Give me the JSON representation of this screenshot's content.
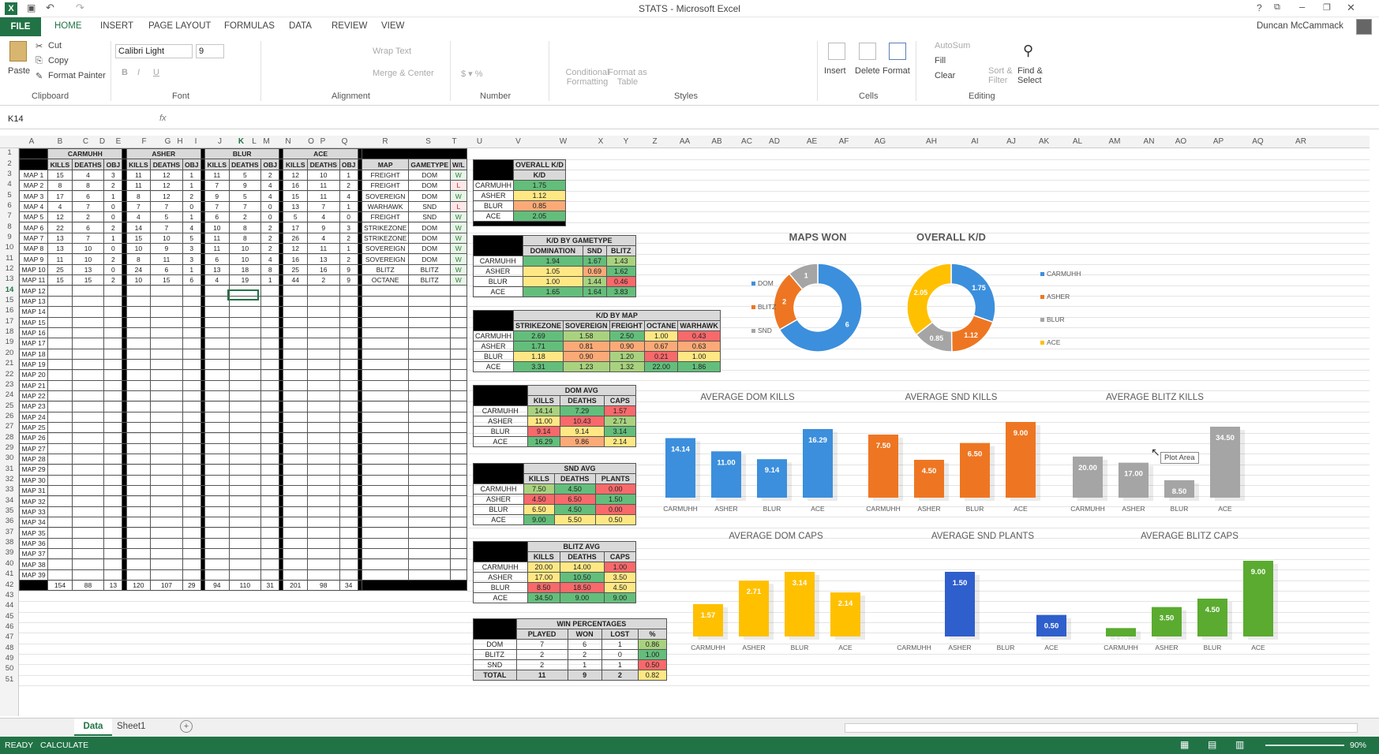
{
  "app": {
    "title": "STATS - Microsoft Excel",
    "user": "Duncan McCammack"
  },
  "ribbon_tabs": [
    "FILE",
    "HOME",
    "INSERT",
    "PAGE LAYOUT",
    "FORMULAS",
    "DATA",
    "REVIEW",
    "VIEW"
  ],
  "ribbon": {
    "paste": "Paste",
    "cut": "Cut",
    "copy": "Copy",
    "format_painter": "Format Painter",
    "font": "Calibri Light",
    "size": "9",
    "wrap": "Wrap Text",
    "merge": "Merge & Center",
    "cond": "Conditional Formatting",
    "fmt_table": "Format as Table",
    "insert": "Insert",
    "delete": "Delete",
    "format": "Format",
    "autosum": "AutoSum",
    "fill": "Fill",
    "clear": "Clear",
    "sort": "Sort & Filter",
    "find": "Find & Select",
    "groups": [
      "Clipboard",
      "Font",
      "Alignment",
      "Number",
      "Styles",
      "Cells",
      "Editing"
    ]
  },
  "namebox": "K14",
  "columns": [
    "A",
    "B",
    "C",
    "D",
    "E",
    "F",
    "G",
    "H",
    "I",
    "J",
    "K",
    "L",
    "M",
    "N",
    "O",
    "P",
    "Q",
    "R",
    "S",
    "T",
    "U",
    "V",
    "W",
    "X",
    "Y",
    "Z",
    "AA",
    "AB",
    "AC",
    "AD",
    "AE",
    "AF",
    "AG",
    "AH",
    "AI",
    "AJ",
    "AK",
    "AL",
    "AM",
    "AN",
    "AO",
    "AP",
    "AQ",
    "AR"
  ],
  "rows": [
    "1",
    "2",
    "3",
    "4",
    "5",
    "6",
    "7",
    "8",
    "9",
    "10",
    "11",
    "12",
    "13",
    "14",
    "15",
    "16",
    "17",
    "18",
    "19",
    "20",
    "21",
    "22",
    "23",
    "24",
    "25",
    "26",
    "27",
    "28",
    "29",
    "30",
    "31",
    "32",
    "33",
    "34",
    "35",
    "36",
    "37",
    "38",
    "39",
    "40",
    "41",
    "42",
    "43",
    "44",
    "45",
    "46",
    "47",
    "48",
    "49",
    "50",
    "51"
  ],
  "maps": [
    "MAP 1",
    "MAP 2",
    "MAP 3",
    "MAP 4",
    "MAP 5",
    "MAP 6",
    "MAP 7",
    "MAP 8",
    "MAP 9",
    "MAP 10",
    "MAP 11",
    "MAP 12",
    "MAP 13",
    "MAP 14",
    "MAP 15",
    "MAP 16",
    "MAP 17",
    "MAP 18",
    "MAP 19",
    "MAP 20",
    "MAP 21",
    "MAP 22",
    "MAP 23",
    "MAP 24",
    "MAP 25",
    "MAP 26",
    "MAP 27",
    "MAP 28",
    "MAP 29",
    "MAP 30",
    "MAP 31",
    "MAP 32",
    "MAP 33",
    "MAP 34",
    "MAP 35",
    "MAP 36",
    "MAP 37",
    "MAP 38",
    "MAP 39"
  ],
  "players": [
    "CARMUHH",
    "ASHER",
    "BLUR",
    "ACE"
  ],
  "stat_headers": [
    "KILLS",
    "DEATHS",
    "OBJ"
  ],
  "stats": [
    [
      [
        15,
        4,
        3
      ],
      [
        8,
        8,
        2
      ],
      [
        17,
        6,
        1
      ],
      [
        4,
        7,
        0
      ],
      [
        12,
        2,
        0
      ],
      [
        22,
        6,
        2
      ],
      [
        13,
        7,
        1
      ],
      [
        13,
        10,
        0
      ],
      [
        11,
        10,
        2
      ],
      [
        25,
        13,
        0
      ],
      [
        15,
        15,
        2
      ]
    ],
    [
      [
        11,
        12,
        1
      ],
      [
        11,
        12,
        1
      ],
      [
        8,
        12,
        2
      ],
      [
        7,
        7,
        0
      ],
      [
        4,
        5,
        1
      ],
      [
        14,
        7,
        4
      ],
      [
        15,
        10,
        5
      ],
      [
        10,
        9,
        3
      ],
      [
        8,
        11,
        3
      ],
      [
        24,
        6,
        1
      ],
      [
        10,
        15,
        6
      ]
    ],
    [
      [
        11,
        5,
        2
      ],
      [
        7,
        9,
        4
      ],
      [
        9,
        5,
        4
      ],
      [
        7,
        7,
        0
      ],
      [
        6,
        2,
        0
      ],
      [
        10,
        8,
        2
      ],
      [
        11,
        8,
        2
      ],
      [
        11,
        10,
        2
      ],
      [
        6,
        10,
        4
      ],
      [
        13,
        18,
        8
      ],
      [
        4,
        19,
        1
      ]
    ],
    [
      [
        12,
        10,
        1
      ],
      [
        16,
        11,
        2
      ],
      [
        15,
        11,
        4
      ],
      [
        13,
        7,
        1
      ],
      [
        5,
        4,
        0
      ],
      [
        17,
        9,
        3
      ],
      [
        26,
        4,
        2
      ],
      [
        12,
        11,
        1
      ],
      [
        16,
        13,
        2
      ],
      [
        25,
        16,
        9
      ],
      [
        44,
        2,
        9
      ]
    ]
  ],
  "totals": [
    [
      154,
      88,
      13
    ],
    [
      120,
      107,
      29
    ],
    [
      94,
      110,
      31
    ],
    [
      201,
      98,
      34
    ]
  ],
  "game_headers": [
    "MAP",
    "GAMETYPE",
    "W/L"
  ],
  "games": [
    [
      "FREIGHT",
      "DOM",
      "W"
    ],
    [
      "FREIGHT",
      "DOM",
      "L"
    ],
    [
      "SOVEREIGN",
      "DOM",
      "W"
    ],
    [
      "WARHAWK",
      "SND",
      "L"
    ],
    [
      "FREIGHT",
      "SND",
      "W"
    ],
    [
      "STRIKEZONE",
      "DOM",
      "W"
    ],
    [
      "STRIKEZONE",
      "DOM",
      "W"
    ],
    [
      "SOVEREIGN",
      "DOM",
      "W"
    ],
    [
      "SOVEREIGN",
      "DOM",
      "W"
    ],
    [
      "BLITZ",
      "BLITZ",
      "W"
    ],
    [
      "OCTANE",
      "BLITZ",
      "W"
    ]
  ],
  "overall_kd": {
    "title": "OVERALL K/D",
    "header": "K/D",
    "values": [
      "1.75",
      "1.12",
      "0.85",
      "2.05"
    ]
  },
  "kd_gametype": {
    "title": "K/D BY GAMETYPE",
    "headers": [
      "DOMINATION",
      "SND",
      "BLITZ"
    ],
    "rows": [
      [
        "1.94",
        "1.67",
        "1.43"
      ],
      [
        "1.05",
        "0.69",
        "1.62"
      ],
      [
        "1.00",
        "1.44",
        "0.46"
      ],
      [
        "1.65",
        "1.64",
        "3.83"
      ]
    ]
  },
  "kd_map": {
    "title": "K/D BY MAP",
    "headers": [
      "STRIKEZONE",
      "SOVEREIGN",
      "FREIGHT",
      "OCTANE",
      "WARHAWK"
    ],
    "rows": [
      [
        "2.69",
        "1.58",
        "2.50",
        "1.00",
        "0.43"
      ],
      [
        "1.71",
        "0.81",
        "0.90",
        "0.67",
        "0.63"
      ],
      [
        "1.18",
        "0.90",
        "1.20",
        "0.21",
        "1.00"
      ],
      [
        "3.31",
        "1.23",
        "1.32",
        "22.00",
        "1.86"
      ]
    ]
  },
  "dom_avg": {
    "title": "DOM AVG",
    "headers": [
      "KILLS",
      "DEATHS",
      "CAPS"
    ],
    "rows": [
      [
        "14.14",
        "7.29",
        "1.57"
      ],
      [
        "11.00",
        "10.43",
        "2.71"
      ],
      [
        "9.14",
        "9.14",
        "3.14"
      ],
      [
        "16.29",
        "9.86",
        "2.14"
      ]
    ]
  },
  "snd_avg": {
    "title": "SND AVG",
    "headers": [
      "KILLS",
      "DEATHS",
      "PLANTS"
    ],
    "rows": [
      [
        "7.50",
        "4.50",
        "0.00"
      ],
      [
        "4.50",
        "6.50",
        "1.50"
      ],
      [
        "6.50",
        "4.50",
        "0.00"
      ],
      [
        "9.00",
        "5.50",
        "0.50"
      ]
    ]
  },
  "blitz_avg": {
    "title": "BLITZ AVG",
    "headers": [
      "KILLS",
      "DEATHS",
      "CAPS"
    ],
    "rows": [
      [
        "20.00",
        "14.00",
        "1.00"
      ],
      [
        "17.00",
        "10.50",
        "3.50"
      ],
      [
        "8.50",
        "18.50",
        "4.50"
      ],
      [
        "34.50",
        "9.00",
        "9.00"
      ]
    ]
  },
  "win_pct": {
    "title": "WIN PERCENTAGES",
    "headers": [
      "PLAYED",
      "WON",
      "LOST",
      "%"
    ],
    "rows": [
      [
        "DOM",
        "7",
        "6",
        "1",
        "0.86"
      ],
      [
        "BLITZ",
        "2",
        "2",
        "0",
        "1.00"
      ],
      [
        "SND",
        "2",
        "1",
        "1",
        "0.50"
      ],
      [
        "TOTAL",
        "11",
        "9",
        "2",
        "0.82"
      ]
    ]
  },
  "chart_data": [
    {
      "type": "pie",
      "title": "MAPS WON",
      "categories": [
        "DOM",
        "BLITZ",
        "SND"
      ],
      "values": [
        6,
        2,
        1
      ],
      "colors": [
        "#3c8fdc",
        "#ee7622",
        "#a5a5a5"
      ]
    },
    {
      "type": "pie",
      "title": "OVERALL K/D",
      "categories": [
        "CARMUHH",
        "ASHER",
        "BLUR",
        "ACE"
      ],
      "values": [
        1.75,
        1.12,
        0.85,
        2.05
      ],
      "colors": [
        "#3c8fdc",
        "#ee7622",
        "#a5a5a5",
        "#ffc000"
      ]
    },
    {
      "type": "bar",
      "title": "AVERAGE DOM KILLS",
      "categories": [
        "CARMUHH",
        "ASHER",
        "BLUR",
        "ACE"
      ],
      "values": [
        14.14,
        11.0,
        9.14,
        16.29
      ],
      "labels": [
        "14.14",
        "11.00",
        "9.14",
        "16.29"
      ],
      "color": "#3c8fdc",
      "ylim": [
        0,
        16.29
      ]
    },
    {
      "type": "bar",
      "title": "AVERAGE SND KILLS",
      "categories": [
        "CARMUHH",
        "ASHER",
        "BLUR",
        "ACE"
      ],
      "values": [
        7.5,
        4.5,
        6.5,
        9.0
      ],
      "labels": [
        "7.50",
        "4.50",
        "6.50",
        "9.00"
      ],
      "color": "#ee7622",
      "ylim": [
        0,
        9
      ]
    },
    {
      "type": "bar",
      "title": "AVERAGE BLITZ KILLS",
      "categories": [
        "CARMUHH",
        "ASHER",
        "BLUR",
        "ACE"
      ],
      "values": [
        20,
        17,
        8.5,
        34.5
      ],
      "labels": [
        "20.00",
        "17.00",
        "8.50",
        "34.50"
      ],
      "color": "#a5a5a5",
      "ylim": [
        0,
        34.5
      ]
    },
    {
      "type": "bar",
      "title": "AVERAGE DOM CAPS",
      "categories": [
        "CARMUHH",
        "ASHER",
        "BLUR",
        "ACE"
      ],
      "values": [
        1.57,
        2.71,
        3.14,
        2.14
      ],
      "labels": [
        "1.57",
        "2.71",
        "3.14",
        "2.14"
      ],
      "color": "#ffc000",
      "ylim": [
        0,
        3.14
      ]
    },
    {
      "type": "bar",
      "title": "AVERAGE SND PLANTS",
      "categories": [
        "CARMUHH",
        "ASHER",
        "BLUR",
        "ACE"
      ],
      "values": [
        0,
        1.5,
        0,
        0.5
      ],
      "labels": [
        "",
        "1.50",
        "",
        "0.50"
      ],
      "color": "#2f5fcc",
      "ylim": [
        0,
        1.5
      ]
    },
    {
      "type": "bar",
      "title": "AVERAGE BLITZ CAPS",
      "categories": [
        "CARMUHH",
        "ASHER",
        "BLUR",
        "ACE"
      ],
      "values": [
        1,
        3.5,
        4.5,
        9
      ],
      "labels": [
        "1.00",
        "3.50",
        "4.50",
        "9.00"
      ],
      "color": "#5aab2f",
      "ylim": [
        0,
        9
      ]
    }
  ],
  "tooltip": "Plot Area",
  "sheets": [
    "Data",
    "Sheet1"
  ],
  "status": {
    "ready": "READY",
    "calc": "CALCULATE",
    "zoom": "90%"
  }
}
